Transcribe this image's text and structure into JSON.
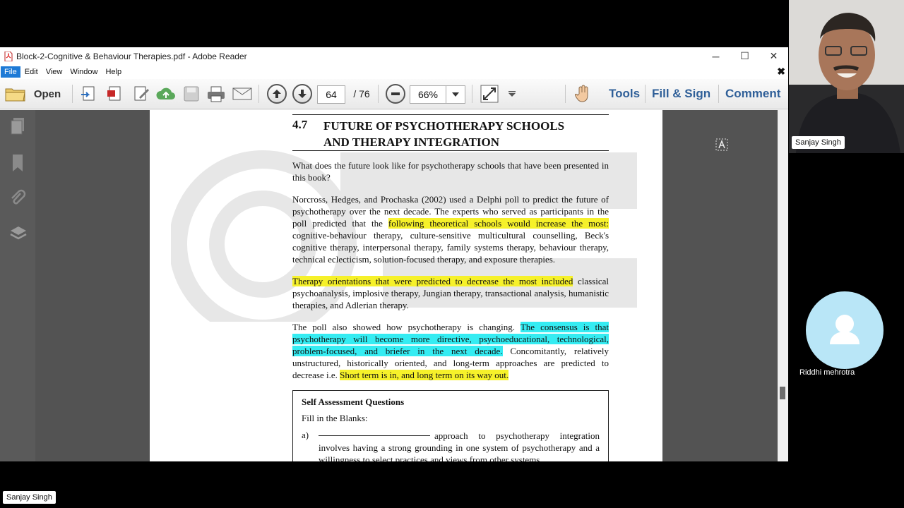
{
  "window": {
    "title": "Block-2-Cognitive & Behaviour Therapies.pdf - Adobe Reader",
    "minimize": "─",
    "maximize": "☐",
    "close": "✕"
  },
  "menu": {
    "items": [
      "File",
      "Edit",
      "View",
      "Window",
      "Help"
    ],
    "close_doc": "✖"
  },
  "toolbar": {
    "open_label": "Open",
    "page_current": "64",
    "page_total": "/ 76",
    "zoom": "66%",
    "tools_label": "Tools",
    "fill_sign_label": "Fill & Sign",
    "comment_label": "Comment"
  },
  "document": {
    "section_number": "4.7",
    "section_title_line1": "FUTURE OF PSYCHOTHERAPY SCHOOLS",
    "section_title_line2": "AND THERAPY INTEGRATION",
    "para1": "What does the future look like for psychotherapy schools that have been presented in this book?",
    "para2_a": "Norcross, Hedges, and Prochaska (2002) used a Delphi poll to predict the future of psychotherapy over the next decade. The experts who served as participants in the poll predicted that the ",
    "para2_hl": "following theoretical schools would increase the most:",
    "para2_b": " cognitive-behaviour therapy, culture-sensitive multicultural counselling, Beck's cognitive therapy, interpersonal therapy, family systems therapy, behaviour therapy, technical eclecticism, solution-focused therapy, and exposure therapies.",
    "para3_hl": "Therapy orientations that were predicted to decrease the most included",
    "para3_b": " classical psychoanalysis, implosive therapy, Jungian therapy, transactional analysis, humanistic therapies, and Adlerian therapy.",
    "para4_a": "The poll also showed how psychotherapy is changing. ",
    "para4_hl1": "The consensus is that psychotherapy will become more directive, psychoeducational, technological, problem-focused, and briefer in the next decade.",
    "para4_b": " Concomitantly, relatively unstructured, historically oriented, and long-term approaches are predicted to decrease i.e. ",
    "para4_hl2": "Short term is in, and long term on its way out.",
    "saq_title": "Self Assessment Questions",
    "saq_sub": "Fill in the Blanks:",
    "saq_a_label": "a)",
    "saq_a_text": "approach to psychotherapy integration involves having a strong grounding in one system of psychotherapy and a willingness to select practices and views from other systems."
  },
  "participants": {
    "main_name": "Sanjay Singh",
    "second_name": "Riddhi mehrotra",
    "bottom_name": "Sanjay Singh"
  },
  "colors": {
    "highlight_yellow": "#f6f12a",
    "highlight_cyan": "#35ecf2",
    "accent_blue": "#2f5f98",
    "avatar_bg": "#b9e6f7"
  }
}
